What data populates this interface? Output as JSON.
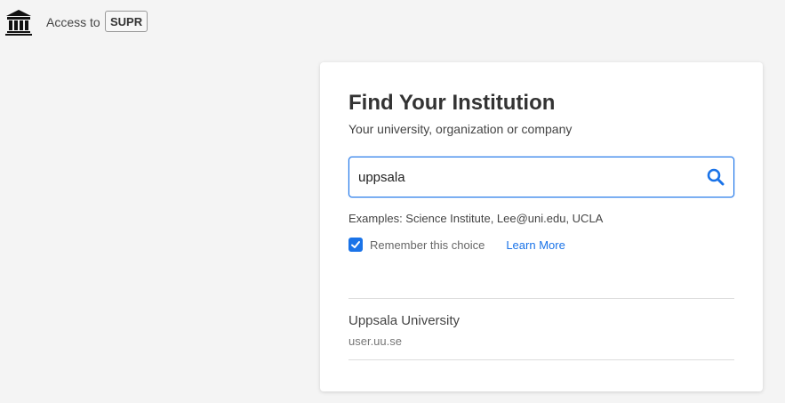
{
  "header": {
    "access_label": "Access to",
    "service_name": "SUPR",
    "logo_icon": "institution-building-icon"
  },
  "card": {
    "title": "Find Your Institution",
    "subtitle": "Your university, organization or company",
    "search": {
      "value": "uppsala",
      "icon": "search-icon"
    },
    "examples": "Examples: Science Institute, Lee@uni.edu, UCLA",
    "remember": {
      "checked": true,
      "label": "Remember this choice"
    },
    "learn_more": "Learn More",
    "results": [
      {
        "name": "Uppsala University",
        "domain": "user.uu.se"
      }
    ]
  },
  "colors": {
    "accent": "#1a73e8",
    "background": "#f4f4f4",
    "card": "#ffffff"
  }
}
